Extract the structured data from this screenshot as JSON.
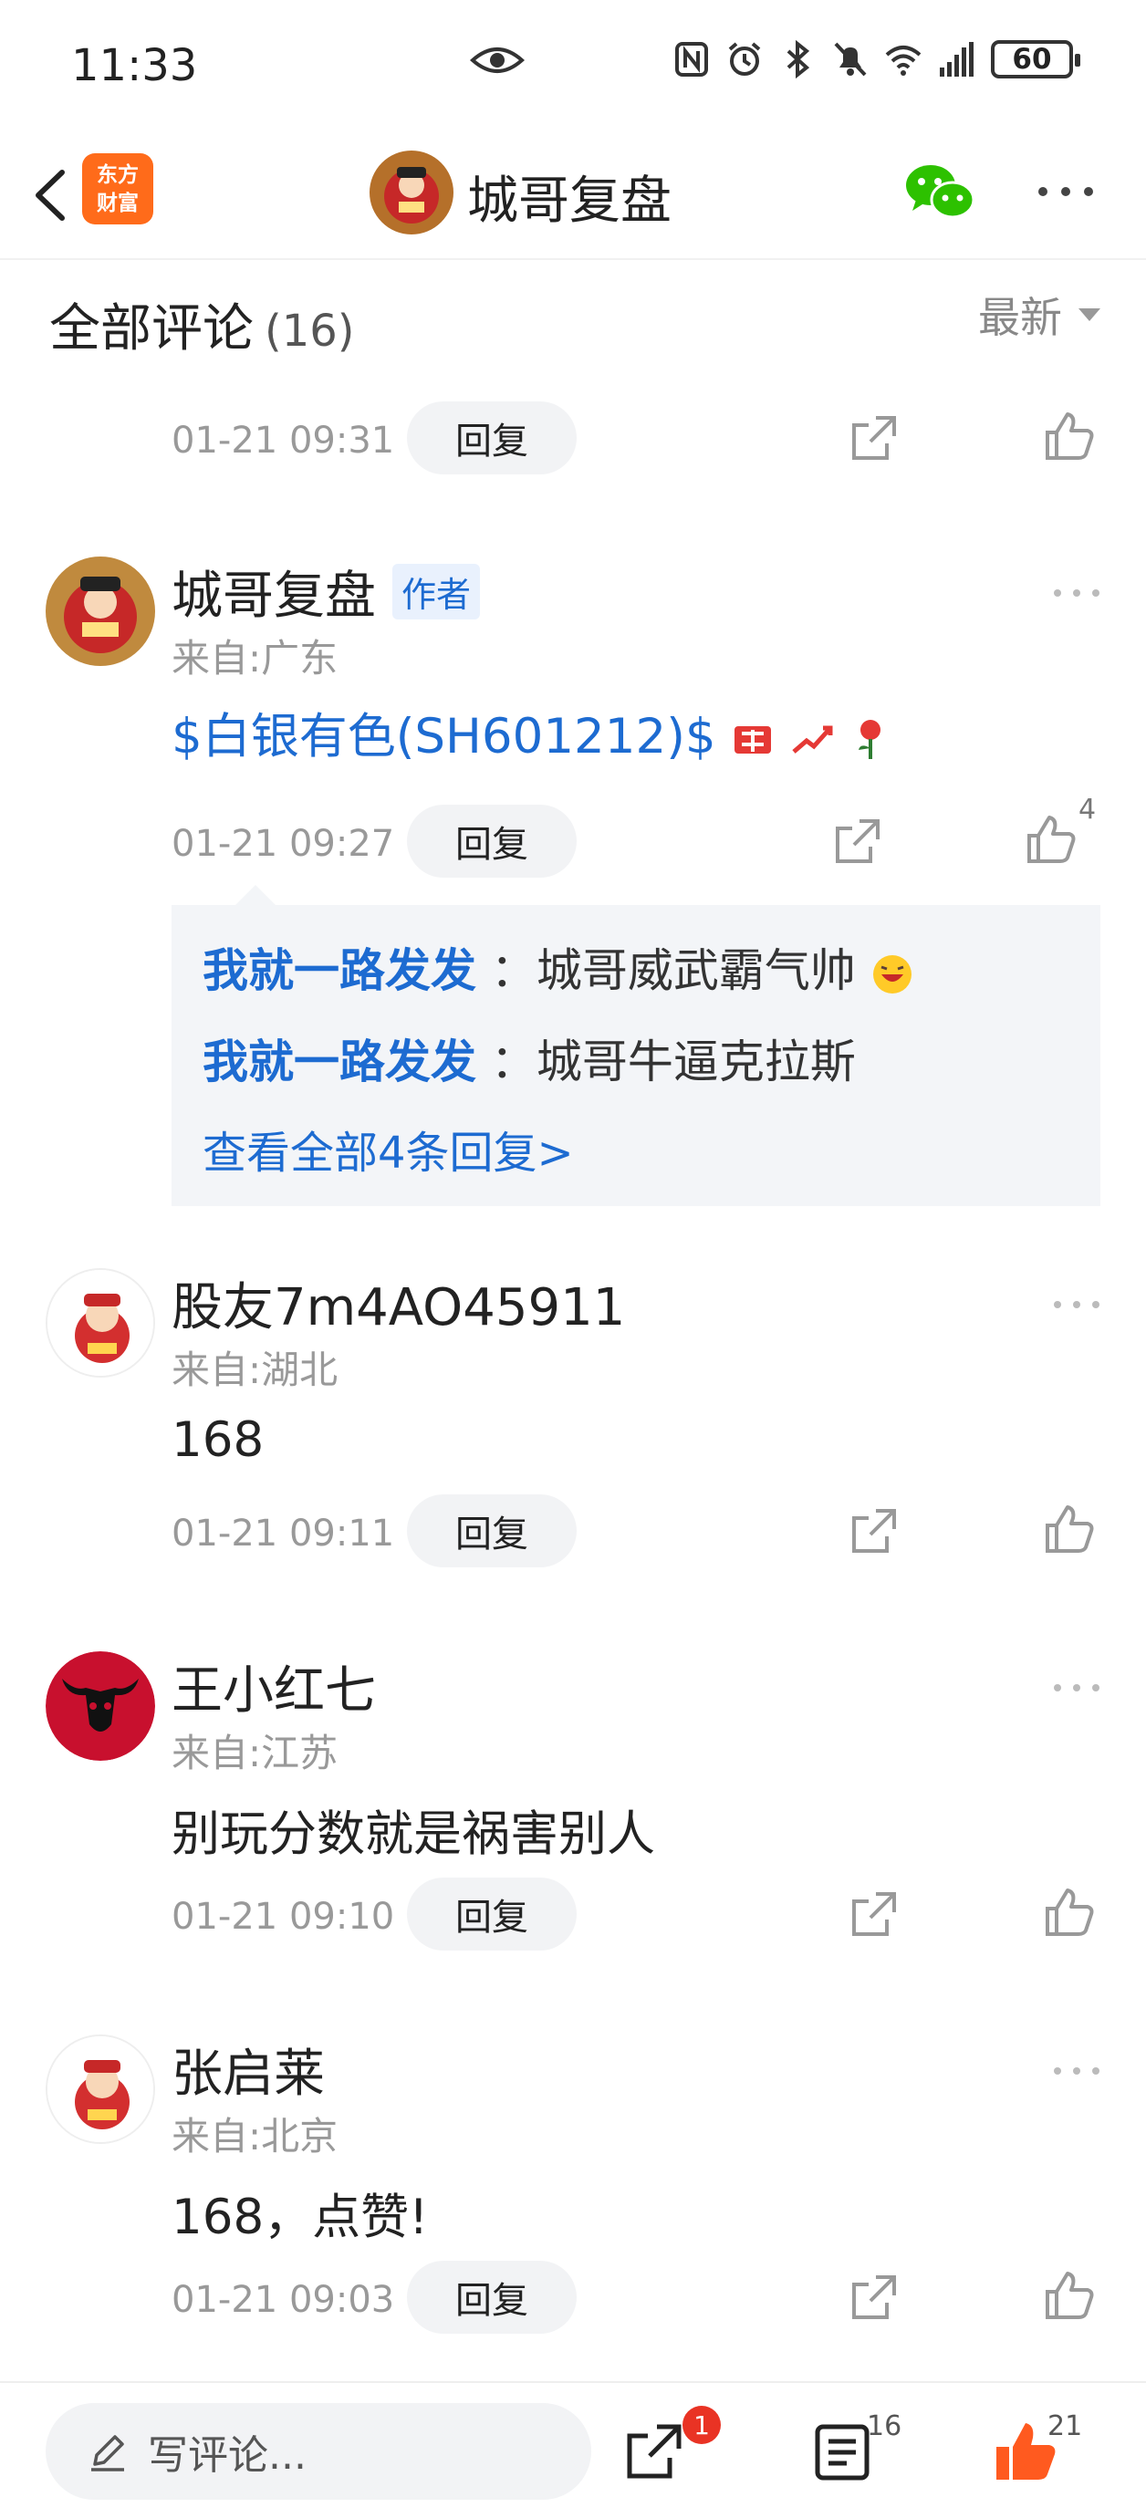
{
  "status_bar": {
    "time": "11:33",
    "battery": "60"
  },
  "header": {
    "logo_line1": "东方",
    "logo_line2": "财富",
    "title": "城哥复盘"
  },
  "comments_header": {
    "title": "全部评论",
    "count": "(16)",
    "sort": "最新"
  },
  "prev_comment": {
    "time": "01-21 09:31",
    "reply_label": "回复"
  },
  "comments": [
    {
      "name": "城哥复盘",
      "badge": "作者",
      "location": "来自:广东",
      "text": "$白银有色(SH601212)$",
      "time": "01-21 09:27",
      "reply_label": "回复",
      "likes": "4",
      "replies": [
        {
          "user": "我就一路发发",
          "text": "：城哥威武霸气帅"
        },
        {
          "user": "我就一路发发",
          "text": "：城哥牛逼克拉斯"
        }
      ],
      "view_all": "查看全部4条回复>"
    },
    {
      "name": "股友7m4AO45911",
      "location": "来自:湖北",
      "text": "168",
      "time": "01-21 09:11",
      "reply_label": "回复"
    },
    {
      "name": "王小红七",
      "location": "来自:江苏",
      "text": "别玩分数就是祸害别人",
      "time": "01-21 09:10",
      "reply_label": "回复"
    },
    {
      "name": "张启莱",
      "location": "来自:北京",
      "text": "168，点赞!",
      "time": "01-21 09:03",
      "reply_label": "回复"
    }
  ],
  "bottom_bar": {
    "placeholder": "写评论...",
    "share_badge": "1",
    "comments_count": "16",
    "likes_count": "21"
  },
  "colors": {
    "link_blue": "#1d6bd1",
    "brand_orange": "#ff6b1a",
    "like_orange": "#ff5a1f",
    "badge_red": "#e93324"
  }
}
